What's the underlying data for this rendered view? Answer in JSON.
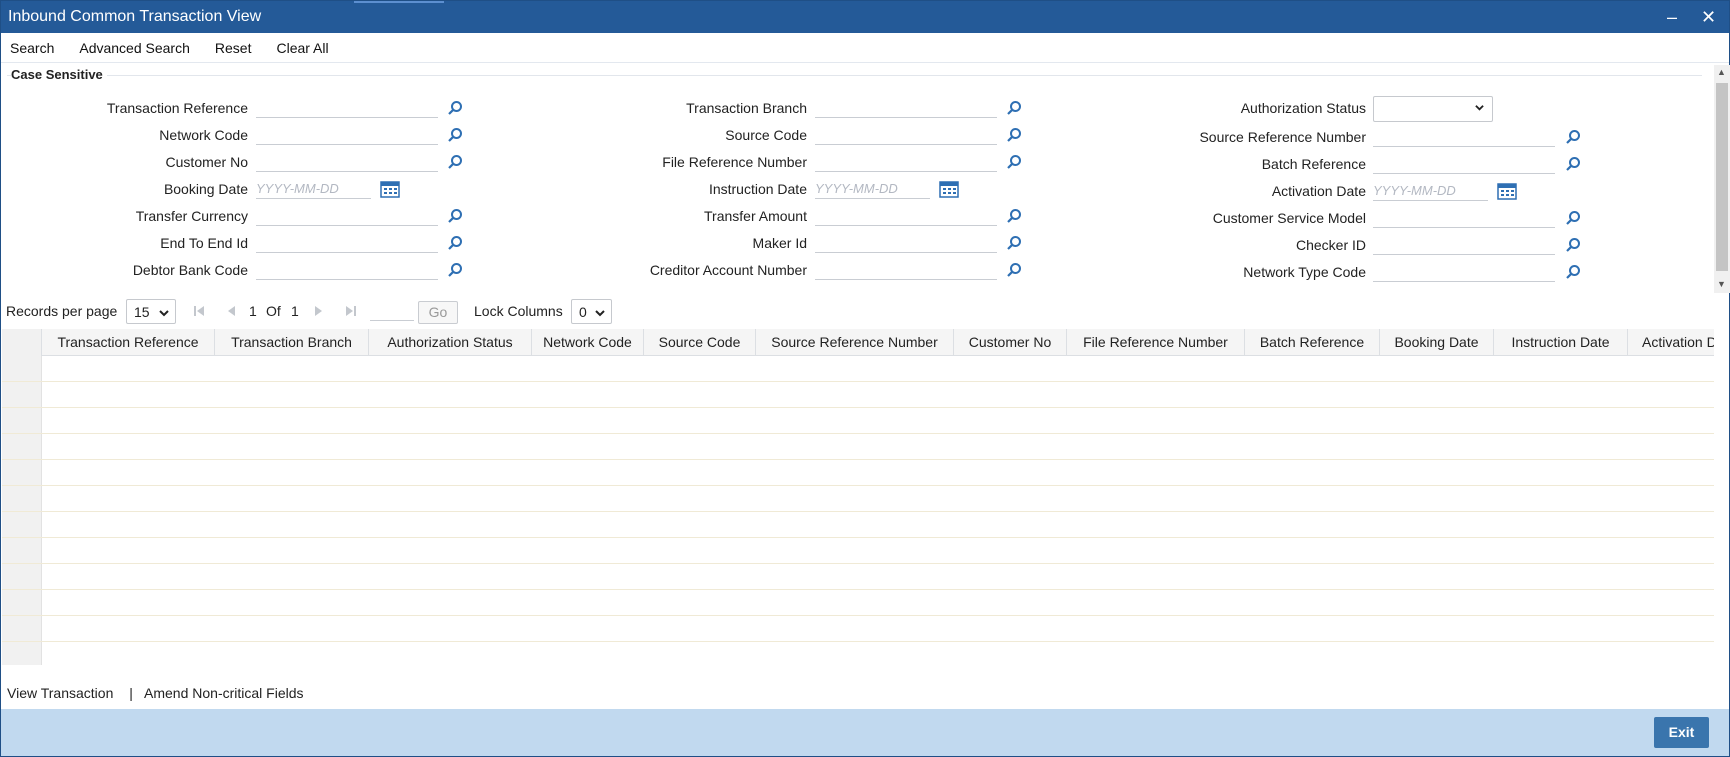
{
  "window": {
    "title": "Inbound Common Transaction View",
    "minimize": "–",
    "close": "✕"
  },
  "toolbar": {
    "items": [
      "Search",
      "Advanced Search",
      "Reset",
      "Clear All"
    ]
  },
  "criteria": {
    "section_title": "Case Sensitive",
    "col1": {
      "transaction_reference": "Transaction Reference",
      "network_code": "Network Code",
      "customer_no": "Customer No",
      "booking_date": "Booking Date",
      "transfer_currency": "Transfer Currency",
      "end_to_end_id": "End To End Id",
      "debtor_bank_code": "Debtor Bank Code"
    },
    "col2": {
      "transaction_branch": "Transaction Branch",
      "source_code": "Source Code",
      "file_reference_number": "File Reference Number",
      "instruction_date": "Instruction Date",
      "transfer_amount": "Transfer Amount",
      "maker_id": "Maker Id",
      "creditor_account_number": "Creditor Account Number"
    },
    "col3": {
      "authorization_status": "Authorization Status",
      "source_reference_number": "Source Reference Number",
      "batch_reference": "Batch Reference",
      "activation_date": "Activation Date",
      "customer_service_model": "Customer Service Model",
      "checker_id": "Checker ID",
      "network_type_code": "Network Type Code"
    },
    "date_placeholder": "YYYY-MM-DD",
    "authorization_status_value": ""
  },
  "pager": {
    "records_label": "Records per page",
    "records_value": "15",
    "page": "1",
    "of_label": "Of",
    "total_pages": "1",
    "go_label": "Go",
    "lock_label": "Lock Columns",
    "lock_value": "0"
  },
  "grid": {
    "columns": [
      "Transaction Reference",
      "Transaction Branch",
      "Authorization Status",
      "Network Code",
      "Source Code",
      "Source Reference Number",
      "Customer No",
      "File Reference Number",
      "Batch Reference",
      "Booking Date",
      "Instruction Date",
      "Activation D"
    ],
    "row_count": 12
  },
  "footer": {
    "view_transaction": "View Transaction",
    "separator": "|",
    "amend": "Amend Non-critical Fields",
    "exit": "Exit"
  },
  "colors": {
    "titlebar": "#245a98",
    "bottombar": "#c1d9ef",
    "exit_button": "#3a75ad",
    "icon_blue": "#2e6fb3"
  }
}
